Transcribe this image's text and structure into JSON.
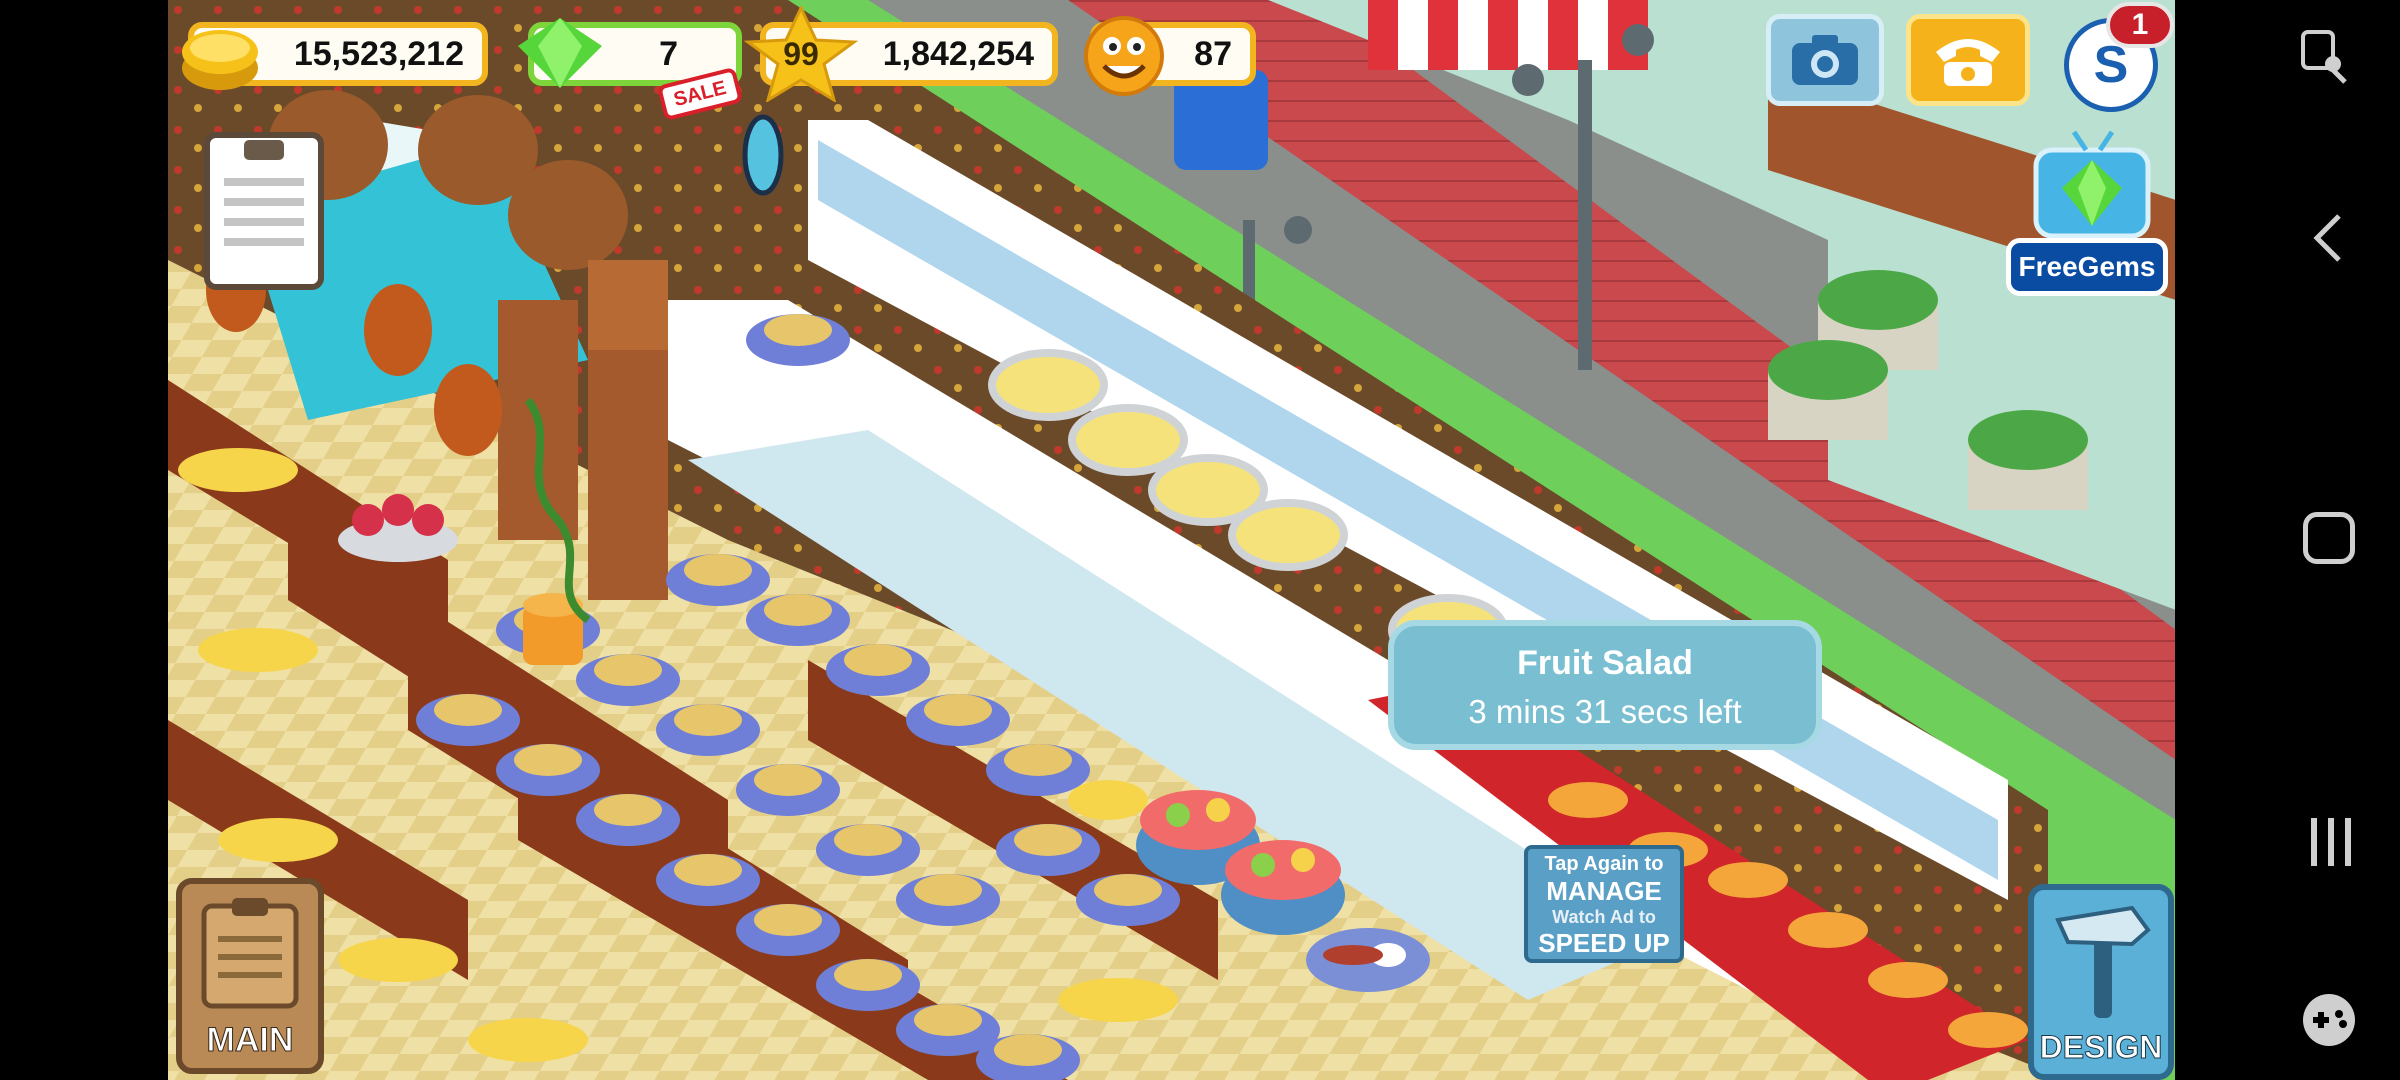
{
  "hud": {
    "coins": "15,523,212",
    "gems": "7",
    "sale_badge": "SALE",
    "level": "99",
    "xp": "1,842,254",
    "staff_count": "87"
  },
  "top_buttons": {
    "notification_count": "1",
    "free_gems_label": "FreeGems"
  },
  "tooltip": {
    "title": "Fruit Salad",
    "time_left": "3 mins 31 secs left"
  },
  "sign": {
    "line1": "Tap Again to",
    "line2": "MANAGE",
    "line3": "Watch Ad to",
    "line4": "SPEED UP"
  },
  "bottom_buttons": {
    "main_label": "MAIN",
    "design_label": "DESIGN"
  },
  "colors": {
    "hud_gold": "#f2b51f",
    "hud_green": "#7dd43b",
    "tooltip_bg": "#79bfd1",
    "free_gems_bg": "#0b4ca3"
  }
}
